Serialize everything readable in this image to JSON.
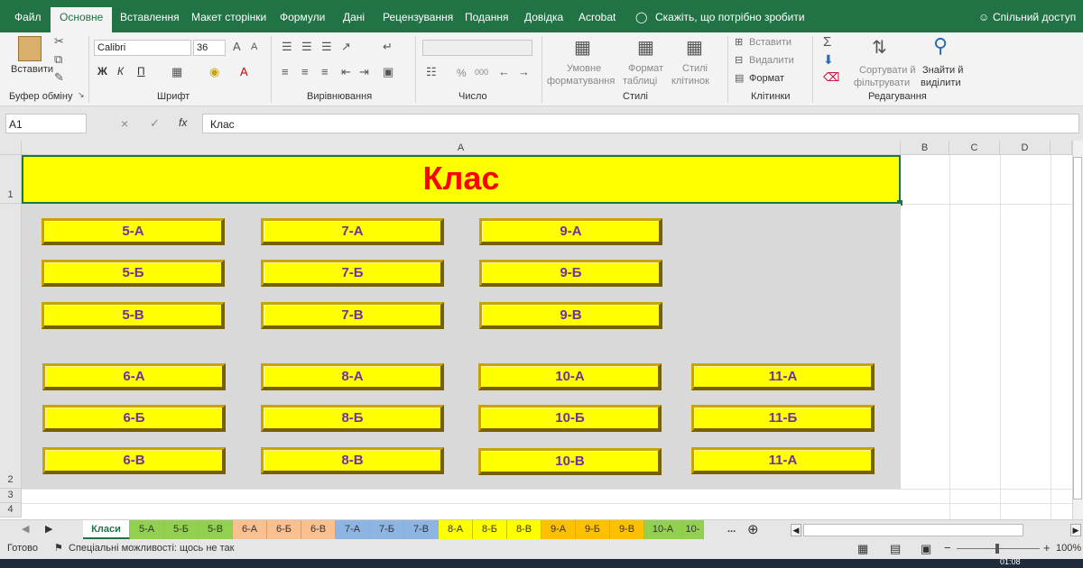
{
  "menubar": {
    "tabs": [
      "Файл",
      "Основне",
      "Вставлення",
      "Макет сторінки",
      "Формули",
      "Дані",
      "Рецензування",
      "Подання",
      "Довідка",
      "Acrobat"
    ],
    "tell_me": "Скажіть, що потрібно зробити",
    "share": "Спільний доступ"
  },
  "ribbon": {
    "paste_label": "Вставити",
    "clipboard_group": "Буфер обміну",
    "font_name": "Calibri",
    "font_size": "36",
    "font_group": "Шрифт",
    "bold": "Ж",
    "italic": "К",
    "underline": "П",
    "align_group": "Вирівнювання",
    "number_group": "Число",
    "percent": "%",
    "thousands": "000",
    "cond_format": [
      "Умовне",
      "форматування"
    ],
    "format_table": [
      "Формат",
      "таблиці"
    ],
    "cell_styles": [
      "Стилі",
      "клітинок"
    ],
    "styles_group": "Стилі",
    "insert": "Вставити",
    "delete": "Видалити",
    "format": "Формат",
    "cells_group": "Клітинки",
    "sort_filter": [
      "Сортувати й",
      "фільтрувати"
    ],
    "find_select": [
      "Знайти й",
      "виділити"
    ],
    "editing_group": "Редагування"
  },
  "formula_bar": {
    "name_box": "A1",
    "cancel": "×",
    "enter": "✓",
    "fx": "fx",
    "content": "Клас"
  },
  "grid": {
    "columns": [
      "A",
      "B",
      "C",
      "D"
    ],
    "rows": [
      "1",
      "2",
      "3",
      "4"
    ],
    "title": "Клас",
    "buttons": {
      "col1": [
        "5-А",
        "5-Б",
        "5-В",
        "6-А",
        "6-Б",
        "6-В"
      ],
      "col2": [
        "7-А",
        "7-Б",
        "7-В",
        "8-А",
        "8-Б",
        "8-В"
      ],
      "col3": [
        "9-А",
        "9-Б",
        "9-В",
        "10-А",
        "10-Б",
        "10-В"
      ],
      "col4": [
        "11-А",
        "11-Б",
        "11-А"
      ]
    }
  },
  "sheet_tabs": [
    {
      "label": "Класи",
      "color": "#ffffff"
    },
    {
      "label": "5-А",
      "color": "#92d050"
    },
    {
      "label": "5-Б",
      "color": "#92d050"
    },
    {
      "label": "5-В",
      "color": "#92d050"
    },
    {
      "label": "6-А",
      "color": "#fac090"
    },
    {
      "label": "6-Б",
      "color": "#fac090"
    },
    {
      "label": "6-В",
      "color": "#fac090"
    },
    {
      "label": "7-А",
      "color": "#8db4e2"
    },
    {
      "label": "7-Б",
      "color": "#8db4e2"
    },
    {
      "label": "7-В",
      "color": "#8db4e2"
    },
    {
      "label": "8-А",
      "color": "#ffff00"
    },
    {
      "label": "8-Б",
      "color": "#ffff00"
    },
    {
      "label": "8-В",
      "color": "#ffff00"
    },
    {
      "label": "9-А",
      "color": "#ffc000"
    },
    {
      "label": "9-Б",
      "color": "#ffc000"
    },
    {
      "label": "9-В",
      "color": "#ffc000"
    },
    {
      "label": "10-А",
      "color": "#92d050"
    },
    {
      "label": "10-",
      "color": "#92d050"
    }
  ],
  "sheet_more": "...",
  "status": {
    "ready": "Готово",
    "accessibility": "Спеціальні можливості: щось не так",
    "zoom": "100%"
  },
  "taskbar_time": "01:08",
  "colors": {
    "accent": "#217346",
    "button_fill": "#ffff00",
    "button_text": "#7030a0",
    "title_text": "#ff0000",
    "sheet_bg": "#d9d9d9"
  }
}
